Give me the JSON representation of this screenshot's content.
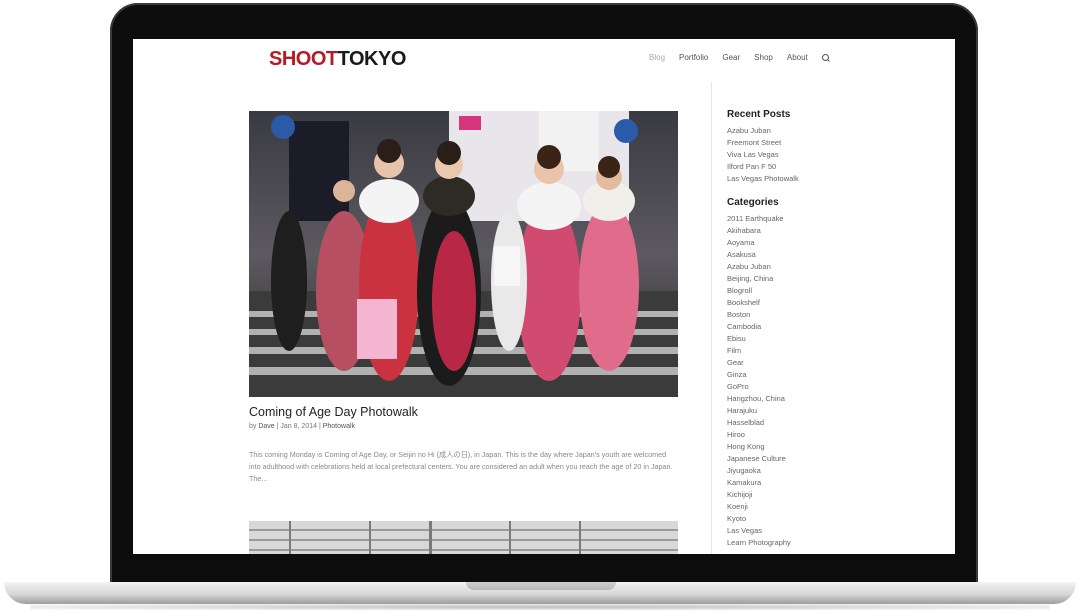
{
  "header": {
    "logo_part1": "SHOOT",
    "logo_part2": "TOKYO",
    "nav": [
      "Blog",
      "Portfolio",
      "Gear",
      "Shop",
      "About"
    ]
  },
  "post": {
    "title": "Coming of Age Day Photowalk",
    "author_prefix": "by ",
    "author": "Dave",
    "date": "Jan 8, 2014",
    "category": "Photowalk",
    "excerpt": "This coming Monday is Coming of Age Day, or Seijin no Hi (成人の日), in Japan.  This is the day where Japan’s youth are welcomed into adulthood with celebrations held at local prefectural centers.  You are considered an adult when you reach the age of 20 in Japan.   The..."
  },
  "sidebar": {
    "recent_title": "Recent Posts",
    "recent": [
      "Azabu Juban",
      "Freemont Street",
      "Viva Las Vegas",
      "Ilford Pan F 50",
      "Las Vegas Photowalk"
    ],
    "categories_title": "Categories",
    "categories": [
      "2011 Earthquake",
      "Akihabara",
      "Aoyama",
      "Asakusa",
      "Azabu Juban",
      "Beijing, China",
      "Blogroll",
      "Bookshelf",
      "Boston",
      "Cambodia",
      "Ebisu",
      "Film",
      "Gear",
      "Ginza",
      "GoPro",
      "Hangzhou, China",
      "Harajuku",
      "Hasselblad",
      "Hiroo",
      "Hong Kong",
      "Japanese Culture",
      "Jiyugaoka",
      "Kamakura",
      "Kichijoji",
      "Koenji",
      "Kyoto",
      "Las Vegas",
      "Learn Photography"
    ]
  },
  "colors": {
    "brand_red": "#b31b26",
    "text_dark": "#222222",
    "link_gray": "#666666"
  }
}
